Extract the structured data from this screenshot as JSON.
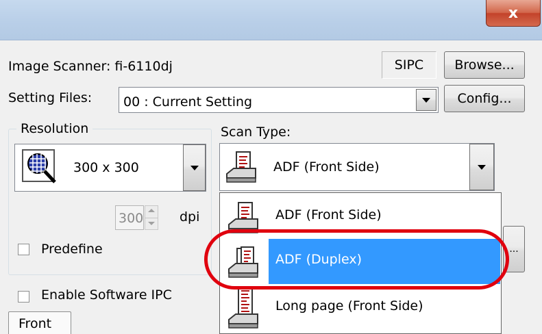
{
  "window": {
    "close_label": "x"
  },
  "scanner": {
    "label": "Image Scanner: fi-6110dj",
    "sipc_label": "SIPC",
    "browse_label": "Browse..."
  },
  "settings": {
    "label": "Setting Files:",
    "value": "00 : Current Setting",
    "config_label": "Config..."
  },
  "resolution": {
    "group_label": "Resolution",
    "value": "300 x 300",
    "dpi_value": "300",
    "dpi_unit": "dpi",
    "predefine_label": "Predefine"
  },
  "scan_type": {
    "label": "Scan Type:",
    "selected": "ADF (Front Side)",
    "options": [
      "ADF (Front Side)",
      "ADF (Duplex)",
      "Long page (Front Side)"
    ],
    "highlighted_index": 1
  },
  "software_ipc": {
    "label": "Enable Software IPC"
  },
  "front_tab": {
    "label": "Front"
  },
  "side_button": {
    "label": "..."
  },
  "colors": {
    "highlight": "#3399ff",
    "annotation": "#e0000e"
  }
}
